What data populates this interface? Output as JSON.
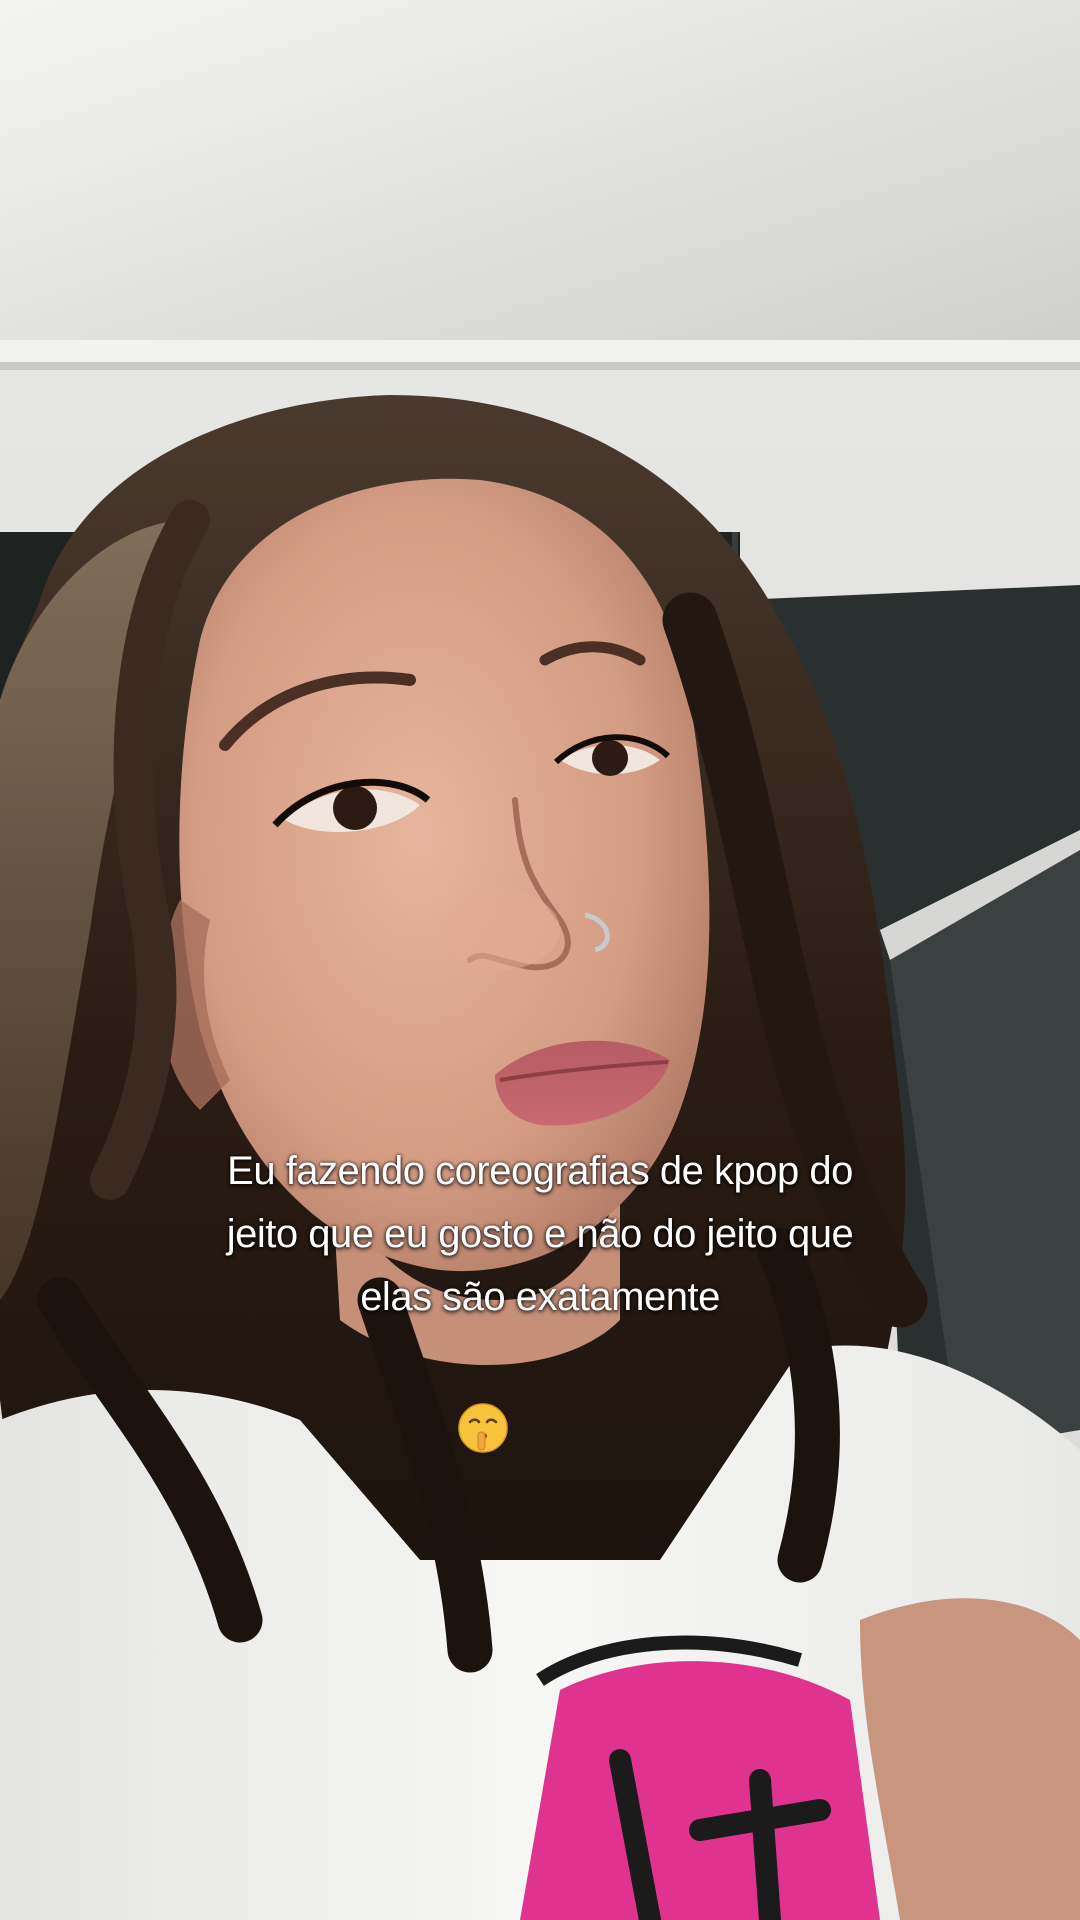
{
  "overlay": {
    "caption_lines": [
      "Eu fazendo coreografias de kpop do",
      "jeito que eu gosto e não do jeito que",
      "elas são exatamente"
    ],
    "emoji": {
      "name": "shushing-face-icon",
      "char": "🤫"
    }
  },
  "colors": {
    "wall": "#e2e2e0",
    "shadow_panel": "#1f2423",
    "hair": "#2a1c14",
    "skin": "#d7a38b",
    "shirt": "#f2f2f0",
    "shirt_print": "#e0338f",
    "caption_text": "#ffffff"
  }
}
